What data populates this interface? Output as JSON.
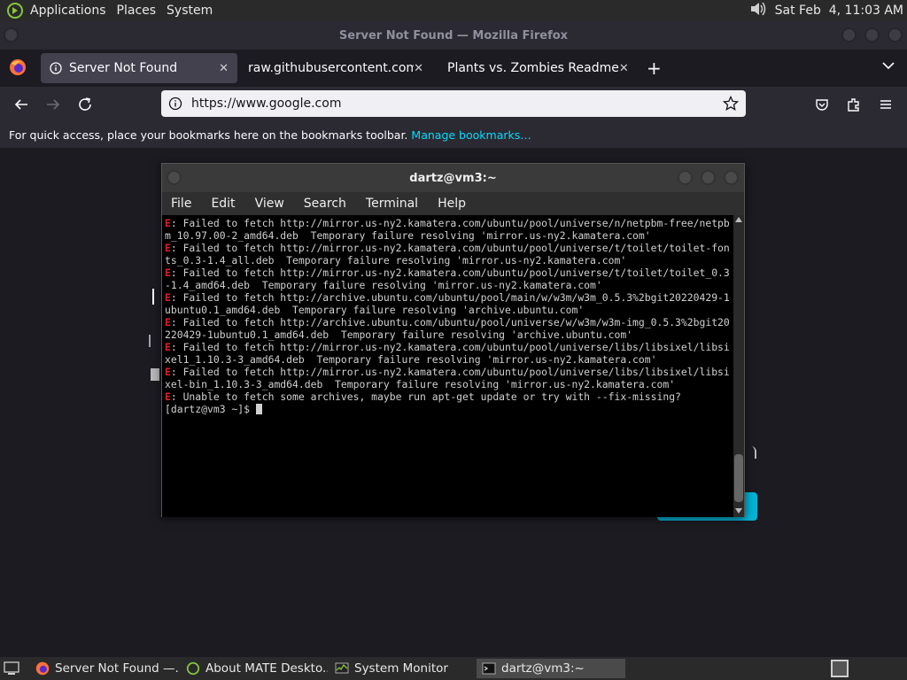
{
  "top_panel": {
    "menus": [
      "Applications",
      "Places",
      "System"
    ],
    "clock": "Sat Feb  4, 11:03 AM"
  },
  "firefox": {
    "window_title": "Server Not Found — Mozilla Firefox",
    "tabs": [
      {
        "label": "Server Not Found",
        "active": true
      },
      {
        "label": "raw.githubusercontent.com/be",
        "active": false
      },
      {
        "label": "Plants vs. Zombies Readme",
        "active": false
      }
    ],
    "url": "https://www.google.com",
    "bookmarks_bar": {
      "text": "For quick access, place your bookmarks here on the bookmarks toolbar.",
      "link": "Manage bookmarks…"
    }
  },
  "terminal": {
    "title": "dartz@vm3:~",
    "menus": [
      "File",
      "Edit",
      "View",
      "Search",
      "Terminal",
      "Help"
    ],
    "lines": [
      {
        "prefix": "E",
        "text": ": Failed to fetch http://mirror.us-ny2.kamatera.com/ubuntu/pool/universe/n/netpbm-free/netpbm_10.97.00-2_amd64.deb  Temporary failure resolving 'mirror.us-ny2.kamatera.com'"
      },
      {
        "prefix": "E",
        "text": ": Failed to fetch http://mirror.us-ny2.kamatera.com/ubuntu/pool/universe/t/toilet/toilet-fonts_0.3-1.4_all.deb  Temporary failure resolving 'mirror.us-ny2.kamatera.com'"
      },
      {
        "prefix": "E",
        "text": ": Failed to fetch http://mirror.us-ny2.kamatera.com/ubuntu/pool/universe/t/toilet/toilet_0.3-1.4_amd64.deb  Temporary failure resolving 'mirror.us-ny2.kamatera.com'"
      },
      {
        "prefix": "E",
        "text": ": Failed to fetch http://archive.ubuntu.com/ubuntu/pool/main/w/w3m/w3m_0.5.3%2bgit20220429-1ubuntu0.1_amd64.deb  Temporary failure resolving 'archive.ubuntu.com'"
      },
      {
        "prefix": "E",
        "text": ": Failed to fetch http://archive.ubuntu.com/ubuntu/pool/universe/w/w3m/w3m-img_0.5.3%2bgit20220429-1ubuntu0.1_amd64.deb  Temporary failure resolving 'archive.ubuntu.com'"
      },
      {
        "prefix": "E",
        "text": ": Failed to fetch http://mirror.us-ny2.kamatera.com/ubuntu/pool/universe/libs/libsixel/libsixel1_1.10.3-3_amd64.deb  Temporary failure resolving 'mirror.us-ny2.kamatera.com'"
      },
      {
        "prefix": "E",
        "text": ": Failed to fetch http://mirror.us-ny2.kamatera.com/ubuntu/pool/universe/libs/libsixel/libsixel-bin_1.10.3-3_amd64.deb  Temporary failure resolving 'mirror.us-ny2.kamatera.com'"
      },
      {
        "prefix": "E",
        "text": ": Unable to fetch some archives, maybe run apt-get update or try with --fix-missing?"
      },
      {
        "prefix": "",
        "text": "[dartz@vm3 ~]$ "
      }
    ]
  },
  "taskbar": [
    {
      "label": "Server Not Found —...",
      "active": false
    },
    {
      "label": "About MATE Deskto...",
      "active": false
    },
    {
      "label": "System Monitor",
      "active": false
    },
    {
      "label": "dartz@vm3:~",
      "active": true
    }
  ],
  "colors": {
    "error": "#e01b24",
    "link": "#00ddff",
    "accent": "#00b3d6"
  },
  "icons": [
    "mate-logo-icon",
    "speaker-icon",
    "firefox-icon",
    "info-icon",
    "close-icon",
    "plus-icon",
    "chevron-down-icon",
    "back-icon",
    "forward-icon",
    "reload-icon",
    "star-icon",
    "pocket-icon",
    "extensions-icon",
    "hamburger-menu-icon",
    "terminal-icon",
    "show-desktop-icon"
  ]
}
